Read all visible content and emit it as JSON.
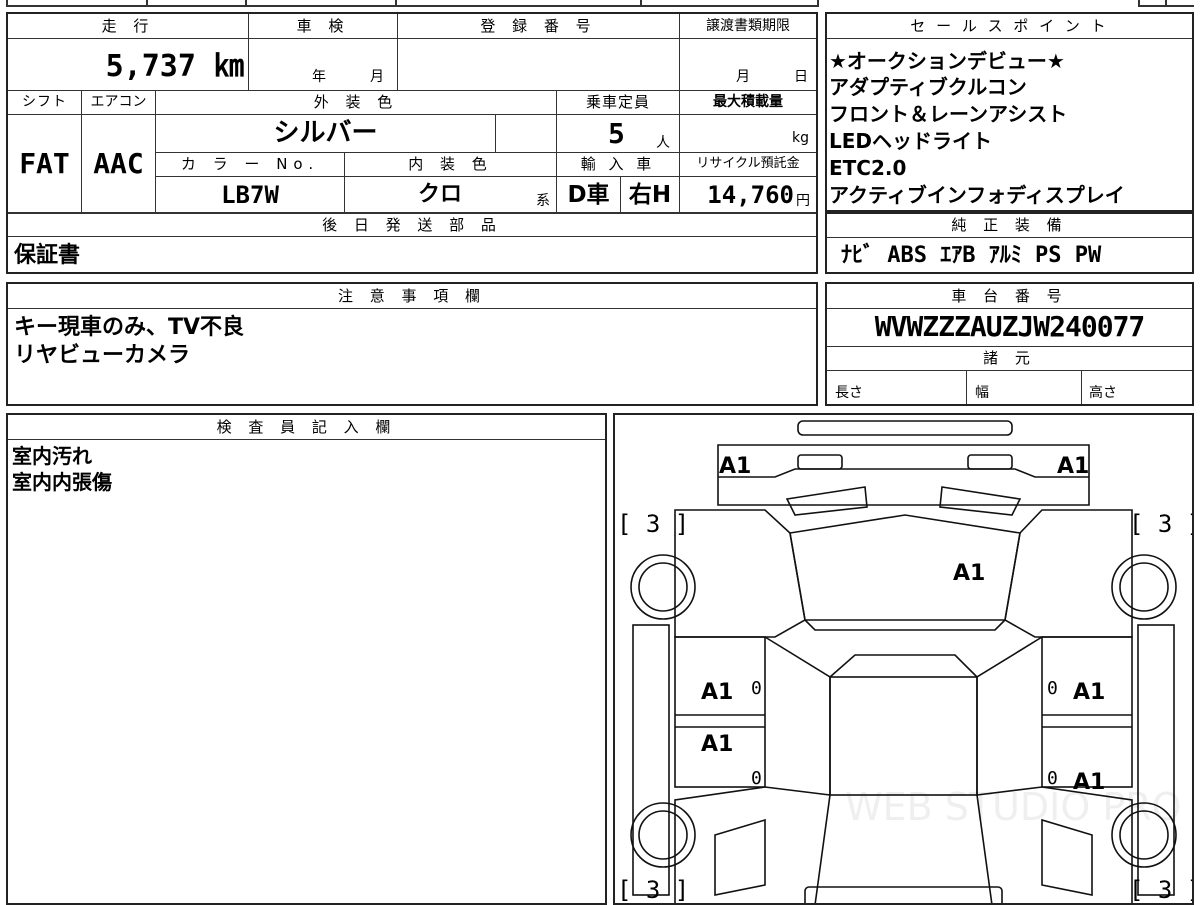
{
  "headers": {
    "mileage": "走 行",
    "inspection": "車 検",
    "registration": "登 録 番 号",
    "transfer_deadline": "譲渡書類期限",
    "shift": "シフト",
    "aircon": "エアコン",
    "exterior_color": "外 装 色",
    "capacity": "乗車定員",
    "max_load": "最大積載量",
    "color_no": "カ ラ ー No.",
    "interior_color": "内 装 色",
    "import": "輸 入 車",
    "recycle": "リサイクル預託金",
    "later_parts": "後 日 発 送 部 品",
    "notes": "注 意 事 項 欄",
    "inspector": "検 査 員 記 入 欄",
    "sales_points": "セ ー ル ス ポ イ ン ト",
    "genuine_equipment": "純 正 装 備",
    "chassis_no": "車 台 番 号",
    "specs": "諸 元"
  },
  "vehicle": {
    "mileage": "5,737 ㎞",
    "insp_year_unit": "年",
    "insp_month_unit": "月",
    "deadline_month_unit": "月",
    "deadline_day_unit": "日",
    "shift": "FAT",
    "aircon": "AAC",
    "exterior_color": "シルバー",
    "capacity": "5",
    "capacity_unit": "人",
    "max_load_unit": "kg",
    "color_no": "LB7W",
    "interior_color": "クロ",
    "interior_suffix": "系",
    "import_type": "D車",
    "steering": "右H",
    "recycle_fee": "14,760",
    "recycle_unit": "円",
    "later_parts": "保証書",
    "chassis_no": "WVWZZZAUZJW240077"
  },
  "notes": [
    "キー現車のみ、TV不良",
    "リヤビューカメラ"
  ],
  "inspector_notes": [
    "室内汚れ",
    "室内内張傷"
  ],
  "sales_points": [
    "★オークションデビュー★",
    "アダプティブクルコン",
    "フロント＆レーンアシスト",
    "LEDヘッドライト",
    "ETC2.0",
    "アクティブインフォディスプレイ"
  ],
  "genuine_equipment": "ﾅﾋﾞ ABS ｴｱB ｱﾙﾐ PS PW",
  "specs": {
    "length": "長さ",
    "width": "幅",
    "height": "高さ"
  },
  "diagram_marks": {
    "mirror_left": "A1",
    "mirror_right": "A1",
    "windshield": "A1",
    "front_door_left": "A1",
    "front_door_right": "A1",
    "rear_door_left": "A1",
    "rear_door_right": "A1",
    "tire_fl": "[ 3 ]",
    "tire_fr": "[ 3 ]",
    "tire_rl": "[ 3 ]",
    "tire_rr": "[ 3 ]",
    "zero": "0"
  },
  "watermark": "WEB STUDIO PRO"
}
